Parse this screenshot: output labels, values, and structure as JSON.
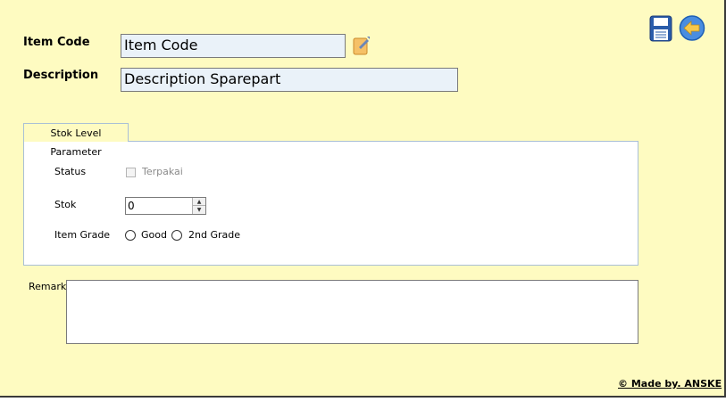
{
  "toolbar": {
    "save_icon": "save-disk-icon",
    "back_icon": "back-arrow-icon",
    "edit_icon": "edit-pencil-icon"
  },
  "fields": {
    "item_code_label": "Item Code",
    "item_code_value": "Item Code",
    "description_label": "Description",
    "description_value": "Description Sparepart"
  },
  "tab": {
    "label": "Stok Level Parameter"
  },
  "stock": {
    "status_label": "Status",
    "status_checkbox_label": "Terpakai",
    "status_checked": false,
    "stok_label": "Stok",
    "stok_value": "0",
    "grade_label": "Item Grade",
    "grade_options": [
      "Good",
      "2nd Grade"
    ]
  },
  "remark": {
    "label": "Remark",
    "value": ""
  },
  "footer": {
    "text": "© Made by. ANSKE"
  },
  "colors": {
    "form_background": "#fefbc1",
    "textbox_background": "#eaf2f9",
    "tab_border": "#a9bfd6"
  }
}
